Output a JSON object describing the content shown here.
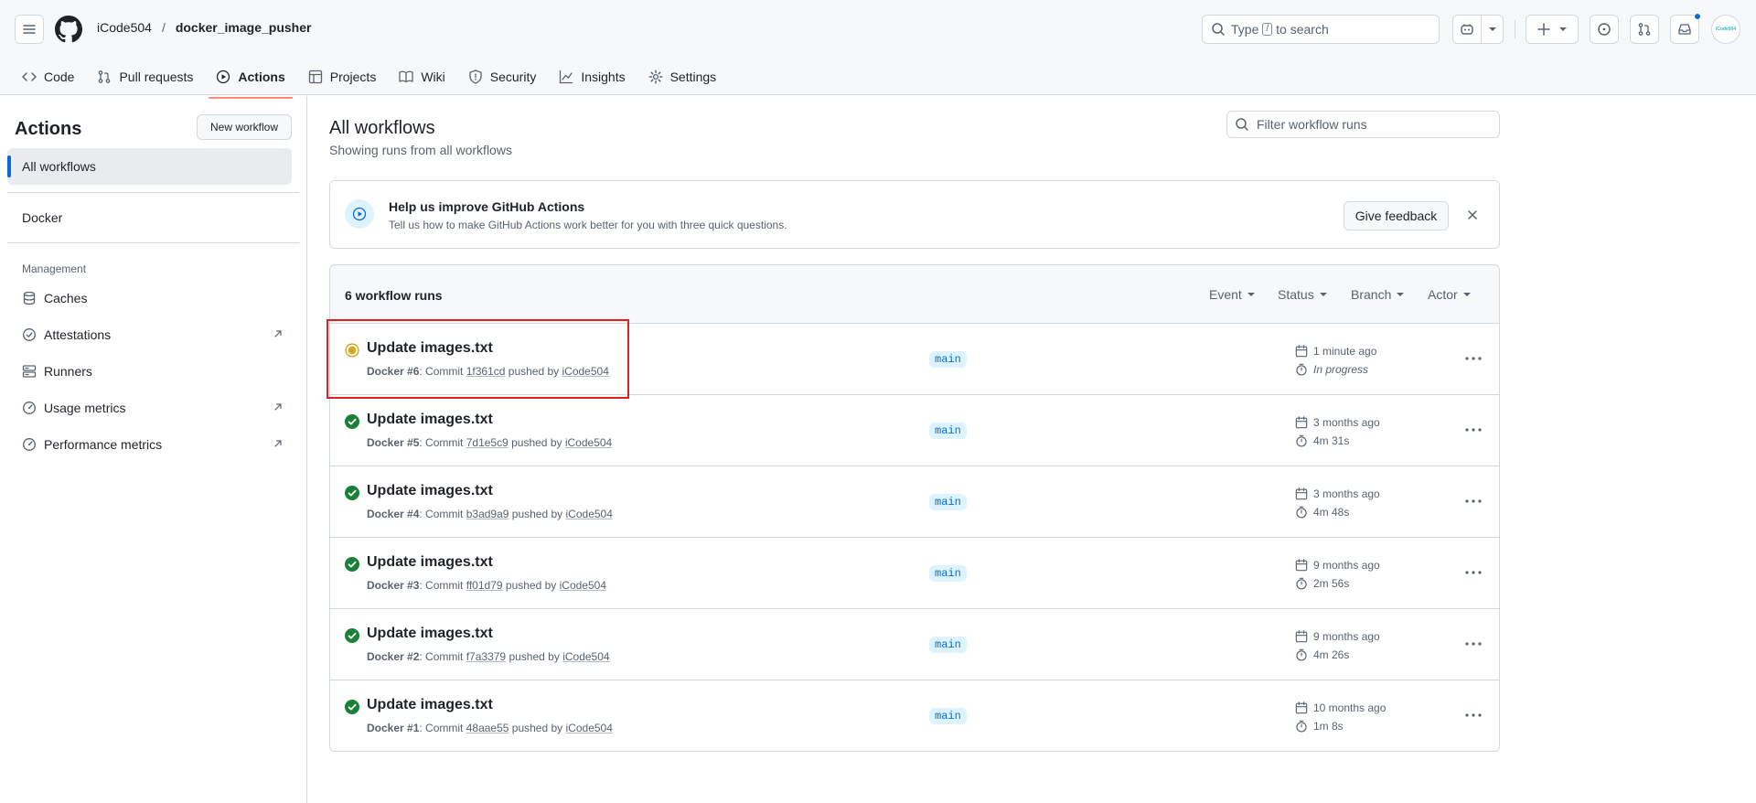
{
  "repo": {
    "owner": "iCode504",
    "separator": "/",
    "name": "docker_image_pusher"
  },
  "search": {
    "before": "Type",
    "key": "/",
    "after": "to search"
  },
  "avatar": {
    "text": "iCode504"
  },
  "nav": [
    {
      "label": "Code",
      "icon": "code-icon"
    },
    {
      "label": "Pull requests",
      "icon": "pull-request-icon"
    },
    {
      "label": "Actions",
      "icon": "play-icon",
      "active": true
    },
    {
      "label": "Projects",
      "icon": "table-icon"
    },
    {
      "label": "Wiki",
      "icon": "book-icon"
    },
    {
      "label": "Security",
      "icon": "shield-icon"
    },
    {
      "label": "Insights",
      "icon": "graph-icon"
    },
    {
      "label": "Settings",
      "icon": "gear-icon"
    }
  ],
  "sidebar": {
    "title": "Actions",
    "new_workflow": "New workflow",
    "all_workflows": "All workflows",
    "workflows": [
      "Docker"
    ],
    "management_heading": "Management",
    "management": [
      {
        "label": "Caches",
        "icon": "database-icon",
        "external": false
      },
      {
        "label": "Attestations",
        "icon": "verified-icon",
        "external": true
      },
      {
        "label": "Runners",
        "icon": "server-icon",
        "external": false
      },
      {
        "label": "Usage metrics",
        "icon": "meter-icon",
        "external": true
      },
      {
        "label": "Performance metrics",
        "icon": "meter-icon",
        "external": true
      }
    ]
  },
  "main": {
    "title": "All workflows",
    "subtitle": "Showing runs from all workflows",
    "filter_placeholder": "Filter workflow runs"
  },
  "banner": {
    "title": "Help us improve GitHub Actions",
    "description": "Tell us how to make GitHub Actions work better for you with three quick questions.",
    "button": "Give feedback"
  },
  "runs": {
    "count": "6 workflow runs",
    "filters": [
      "Event",
      "Status",
      "Branch",
      "Actor"
    ],
    "items": [
      {
        "title": "Update images.txt",
        "workflow": "Docker #6",
        "commit_label": ": Commit",
        "sha": "1f361cd",
        "pushed": "pushed by",
        "user": "iCode504",
        "branch": "main",
        "when": "1 minute ago",
        "duration": "In progress",
        "status": "in_progress"
      },
      {
        "title": "Update images.txt",
        "workflow": "Docker #5",
        "commit_label": ": Commit",
        "sha": "7d1e5c9",
        "pushed": "pushed by",
        "user": "iCode504",
        "branch": "main",
        "when": "3 months ago",
        "duration": "4m 31s",
        "status": "success"
      },
      {
        "title": "Update images.txt",
        "workflow": "Docker #4",
        "commit_label": ": Commit",
        "sha": "b3ad9a9",
        "pushed": "pushed by",
        "user": "iCode504",
        "branch": "main",
        "when": "3 months ago",
        "duration": "4m 48s",
        "status": "success"
      },
      {
        "title": "Update images.txt",
        "workflow": "Docker #3",
        "commit_label": ": Commit",
        "sha": "ff01d79",
        "pushed": "pushed by",
        "user": "iCode504",
        "branch": "main",
        "when": "9 months ago",
        "duration": "2m 56s",
        "status": "success"
      },
      {
        "title": "Update images.txt",
        "workflow": "Docker #2",
        "commit_label": ": Commit",
        "sha": "f7a3379",
        "pushed": "pushed by",
        "user": "iCode504",
        "branch": "main",
        "when": "9 months ago",
        "duration": "4m 26s",
        "status": "success"
      },
      {
        "title": "Update images.txt",
        "workflow": "Docker #1",
        "commit_label": ": Commit",
        "sha": "48aae55",
        "pushed": "pushed by",
        "user": "iCode504",
        "branch": "main",
        "when": "10 months ago",
        "duration": "1m 8s",
        "status": "success"
      }
    ]
  },
  "colors": {
    "accent": "#0969da",
    "success": "#1a7f37",
    "in_progress": "#bf8700",
    "tab_underline": "#fd8c73",
    "annotation": "#e02020"
  }
}
